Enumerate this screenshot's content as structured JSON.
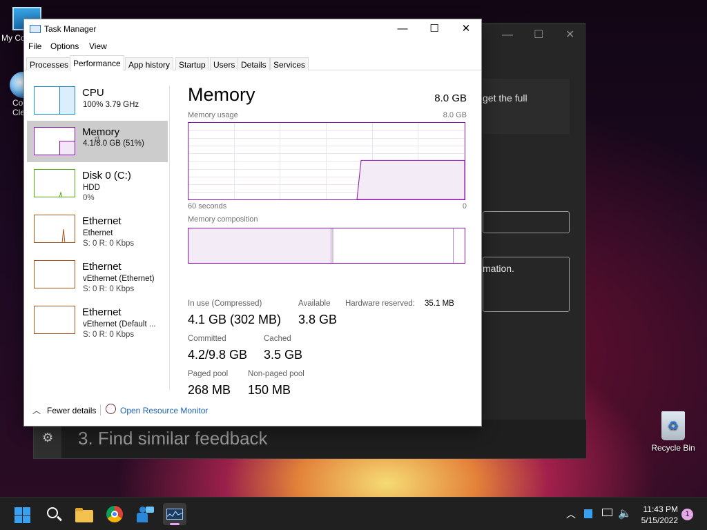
{
  "desktop": {
    "icons": [
      {
        "label": "My Co",
        "name": "this-pc"
      },
      {
        "label": "Co\nCle",
        "name": "ccleaner"
      },
      {
        "label": "Recycle Bin",
        "name": "recycle-bin"
      }
    ]
  },
  "background_window": {
    "text_fragment_1": "get the full",
    "text_fragment_2": "mation.",
    "bottom_text": "3. Find similar feedback"
  },
  "task_manager": {
    "title": "Task Manager",
    "menu": [
      "File",
      "Options",
      "View"
    ],
    "tabs": [
      "Processes",
      "Performance",
      "App history",
      "Startup",
      "Users",
      "Details",
      "Services"
    ],
    "active_tab": "Performance",
    "sidebar": [
      {
        "name": "CPU",
        "line2": "100%  3.79 GHz",
        "line3": "",
        "color": "#1a8ac7"
      },
      {
        "name": "Memory",
        "line2": "4.1/8.0 GB (51%)",
        "line3": "",
        "color": "#8b12ae"
      },
      {
        "name": "Disk 0 (C:)",
        "line2": "HDD",
        "line3": "0%",
        "color": "#4da60c"
      },
      {
        "name": "Ethernet",
        "line2": "Ethernet",
        "line3": "S: 0  R: 0 Kbps",
        "color": "#a7541b"
      },
      {
        "name": "Ethernet",
        "line2": "vEthernet (Ethernet)",
        "line3": "S: 0  R: 0 Kbps",
        "color": "#a7541b"
      },
      {
        "name": "Ethernet",
        "line2": "vEthernet (Default ...",
        "line3": "S: 0  R: 0 Kbps",
        "color": "#a7541b"
      }
    ],
    "main": {
      "title": "Memory",
      "total": "8.0 GB",
      "usage_label": "Memory usage",
      "usage_max": "8.0 GB",
      "time_label": "60 seconds",
      "time_end": "0",
      "composition_label": "Memory composition",
      "usage_fraction": 0.51,
      "stats": {
        "in_use_label": "In use (Compressed)",
        "in_use_value": "4.1 GB (302 MB)",
        "available_label": "Available",
        "available_value": "3.8 GB",
        "hw_reserved_label": "Hardware reserved:",
        "hw_reserved_value": "35.1 MB",
        "committed_label": "Committed",
        "committed_value": "4.2/9.8 GB",
        "cached_label": "Cached",
        "cached_value": "3.5 GB",
        "paged_label": "Paged pool",
        "paged_value": "268 MB",
        "nonpaged_label": "Non-paged pool",
        "nonpaged_value": "150 MB"
      }
    },
    "footer": {
      "fewer_details": "Fewer details",
      "open_monitor": "Open Resource Monitor"
    }
  },
  "taskbar": {
    "apps": [
      "start-icon",
      "search-icon",
      "file-explorer-icon",
      "chrome-icon",
      "feedback-hub-icon",
      "task-manager-icon"
    ],
    "time": "11:43 PM",
    "date": "5/15/2022",
    "notification_count": "1"
  },
  "colors": {
    "memory_accent": "#8b12ae",
    "cpu_accent": "#1a8ac7",
    "disk_accent": "#4da60c",
    "ethernet_accent": "#a7541b",
    "link": "#1a5fb4"
  }
}
